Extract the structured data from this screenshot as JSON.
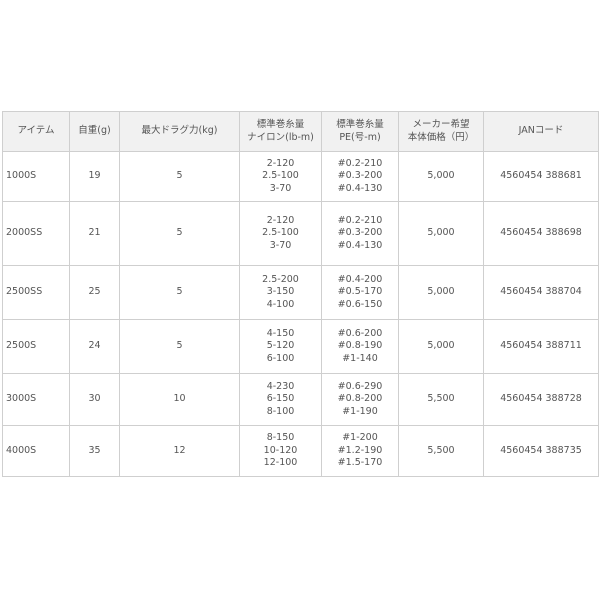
{
  "table": {
    "headers": [
      [
        "アイテム"
      ],
      [
        "自重(g)"
      ],
      [
        "最大ドラグ力(kg)"
      ],
      [
        "標準巻糸量",
        "ナイロン(lb-m)"
      ],
      [
        "標準巻糸量",
        "PE(号-m)"
      ],
      [
        "メーカー希望",
        "本体価格（円）"
      ],
      [
        "JANコード"
      ]
    ],
    "rows": [
      {
        "item": "1000S",
        "weight": "19",
        "drag": "5",
        "nylon": [
          "2-120",
          "2.5-100",
          "3-70"
        ],
        "pe": [
          "#0.2-210",
          "#0.3-200",
          "#0.4-130"
        ],
        "price": "5,000",
        "jan": "4560454 388681"
      },
      {
        "item": "2000SS",
        "weight": "21",
        "drag": "5",
        "nylon": [
          "2-120",
          "2.5-100",
          "3-70"
        ],
        "pe": [
          "#0.2-210",
          "#0.3-200",
          "#0.4-130"
        ],
        "price": "5,000",
        "jan": "4560454 388698"
      },
      {
        "item": "2500SS",
        "weight": "25",
        "drag": "5",
        "nylon": [
          "2.5-200",
          "3-150",
          "4-100"
        ],
        "pe": [
          "#0.4-200",
          "#0.5-170",
          "#0.6-150"
        ],
        "price": "5,000",
        "jan": "4560454 388704"
      },
      {
        "item": "2500S",
        "weight": "24",
        "drag": "5",
        "nylon": [
          "4-150",
          "5-120",
          "6-100"
        ],
        "pe": [
          "#0.6-200",
          "#0.8-190",
          "#1-140"
        ],
        "price": "5,000",
        "jan": "4560454 388711"
      },
      {
        "item": "3000S",
        "weight": "30",
        "drag": "10",
        "nylon": [
          "4-230",
          "6-150",
          "8-100"
        ],
        "pe": [
          "#0.6-290",
          "#0.8-200",
          "#1-190"
        ],
        "price": "5,500",
        "jan": "4560454 388728"
      },
      {
        "item": "4000S",
        "weight": "35",
        "drag": "12",
        "nylon": [
          "8-150",
          "10-120",
          "12-100"
        ],
        "pe": [
          "#1-200",
          "#1.2-190",
          "#1.5-170"
        ],
        "price": "5,500",
        "jan": "4560454 388735"
      }
    ]
  }
}
